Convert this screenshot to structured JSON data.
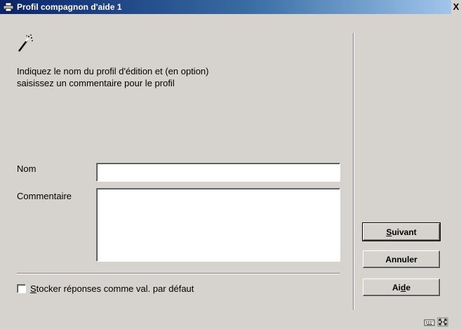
{
  "window": {
    "title": "Profil compagnon d'aide 1",
    "close_glyph": "X"
  },
  "instructions": {
    "line1": "Indiquez le nom du profil d'édition et (en option)",
    "line2": "saisissez un commentaire pour le profil"
  },
  "form": {
    "name_label": "Nom",
    "name_value": "",
    "comment_label": "Commentaire",
    "comment_value": ""
  },
  "checkbox": {
    "label_mnemonic": "S",
    "label_rest": "tocker réponses comme val. par défaut",
    "checked": false
  },
  "buttons": {
    "next": {
      "mnemonic": "S",
      "rest": "uivant"
    },
    "cancel": {
      "label": "Annuler"
    },
    "help": {
      "before": "Ai",
      "mnemonic": "d",
      "after": "e"
    }
  },
  "icons": [
    "printer-icon",
    "wand-icon",
    "keyboard-icon",
    "resize-icon"
  ]
}
